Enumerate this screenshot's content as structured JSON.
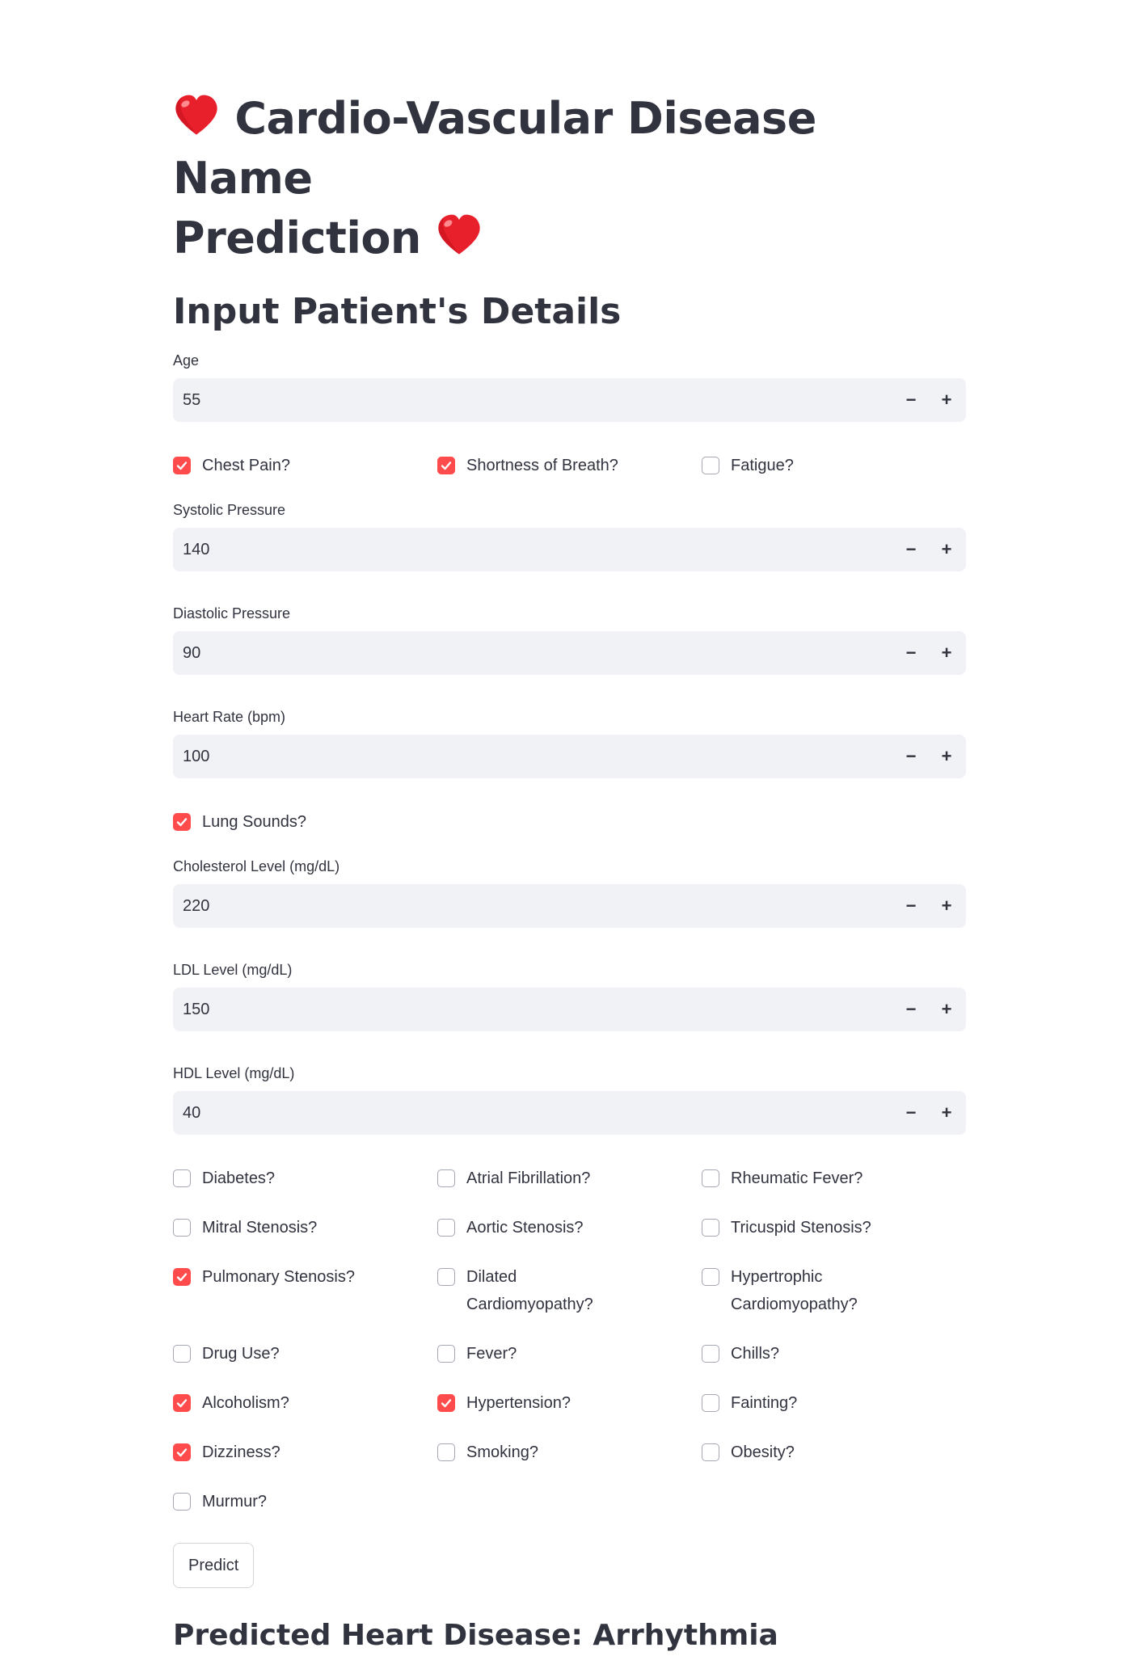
{
  "page": {
    "title_line1": "Cardio-Vascular Disease Name",
    "title_line2": "Prediction",
    "title_icon": "heart-emoji",
    "subheader": "Input Patient's Details"
  },
  "colors": {
    "accent": "#ff4b4b",
    "input_bg": "#f0f2f6",
    "text": "#31333f"
  },
  "inputs": {
    "age": {
      "label": "Age",
      "value": "55"
    },
    "systolic": {
      "label": "Systolic Pressure",
      "value": "140"
    },
    "diastolic": {
      "label": "Diastolic Pressure",
      "value": "90"
    },
    "heart_rate": {
      "label": "Heart Rate (bpm)",
      "value": "100"
    },
    "cholesterol": {
      "label": "Cholesterol Level (mg/dL)",
      "value": "220"
    },
    "ldl": {
      "label": "LDL Level (mg/dL)",
      "value": "150"
    },
    "hdl": {
      "label": "HDL Level (mg/dL)",
      "value": "40"
    }
  },
  "stepper": {
    "minus": "−",
    "plus": "+"
  },
  "checks": {
    "chest_pain": {
      "label": "Chest Pain?",
      "checked": true
    },
    "shortness_breath": {
      "label": "Shortness of Breath?",
      "checked": true
    },
    "fatigue": {
      "label": "Fatigue?",
      "checked": false
    },
    "lung_sounds": {
      "label": "Lung Sounds?",
      "checked": true
    },
    "diabetes": {
      "label": "Diabetes?",
      "checked": false
    },
    "atrial_fib": {
      "label": "Atrial Fibrillation?",
      "checked": false
    },
    "rheumatic_fever": {
      "label": "Rheumatic Fever?",
      "checked": false
    },
    "mitral_stenosis": {
      "label": "Mitral Stenosis?",
      "checked": false
    },
    "aortic_stenosis": {
      "label": "Aortic Stenosis?",
      "checked": false
    },
    "tricuspid_stenosis": {
      "label": "Tricuspid Stenosis?",
      "checked": false
    },
    "pulmonary_stenosis": {
      "label": "Pulmonary Stenosis?",
      "checked": true
    },
    "dilated_cardio": {
      "label": "Dilated Cardiomyopathy?",
      "checked": false
    },
    "hypertrophic_cardio": {
      "label": "Hypertrophic Cardiomyopathy?",
      "checked": false
    },
    "drug_use": {
      "label": "Drug Use?",
      "checked": false
    },
    "fever": {
      "label": "Fever?",
      "checked": false
    },
    "chills": {
      "label": "Chills?",
      "checked": false
    },
    "alcoholism": {
      "label": "Alcoholism?",
      "checked": true
    },
    "hypertension": {
      "label": "Hypertension?",
      "checked": true
    },
    "fainting": {
      "label": "Fainting?",
      "checked": false
    },
    "dizziness": {
      "label": "Dizziness?",
      "checked": true
    },
    "smoking": {
      "label": "Smoking?",
      "checked": false
    },
    "obesity": {
      "label": "Obesity?",
      "checked": false
    },
    "murmur": {
      "label": "Murmur?",
      "checked": false
    }
  },
  "predict_button": "Predict",
  "result": "Predicted Heart Disease: Arrhythmia"
}
